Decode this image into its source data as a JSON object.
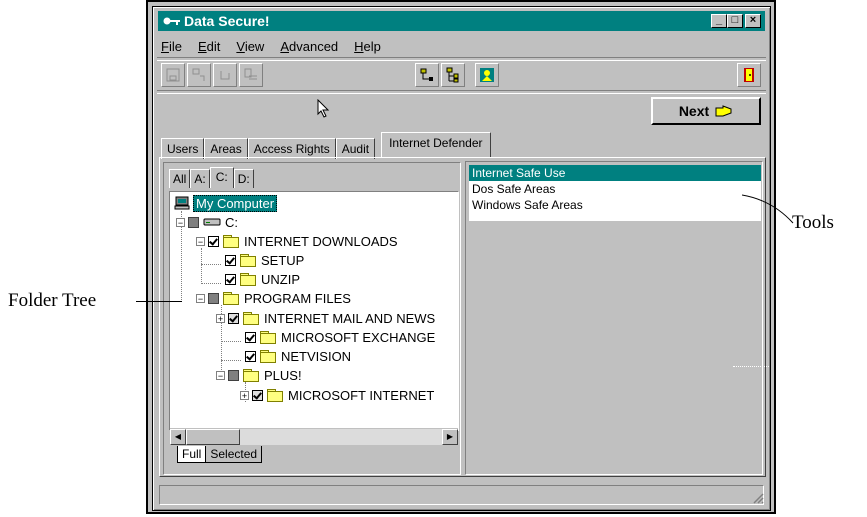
{
  "window": {
    "title": "Data Secure!",
    "min": "_",
    "max": "□",
    "close": "×"
  },
  "menu": [
    "File",
    "Edit",
    "View",
    "Advanced",
    "Help"
  ],
  "next_button": {
    "label": "Next"
  },
  "tabs": [
    "Users",
    "Areas",
    "Access Rights",
    "Audit",
    "Internet Defender"
  ],
  "drive_tabs": [
    "All",
    "A:",
    "C:",
    "D:"
  ],
  "tree": {
    "root": "My Computer",
    "drive": "C:",
    "items": [
      {
        "label": "INTERNET DOWNLOADS",
        "level": 2
      },
      {
        "label": "SETUP",
        "level": 3
      },
      {
        "label": "UNZIP",
        "level": 3
      },
      {
        "label": "PROGRAM FILES",
        "level": 2
      },
      {
        "label": "INTERNET MAIL AND NEWS",
        "level": 3
      },
      {
        "label": "MICROSOFT EXCHANGE",
        "level": 3
      },
      {
        "label": "NETVISION",
        "level": 3
      },
      {
        "label": "PLUS!",
        "level": 3
      },
      {
        "label": "MICROSOFT INTERNET",
        "level": 4
      }
    ]
  },
  "view_tabs": [
    "Full",
    "Selected"
  ],
  "tools_list": [
    "Internet Safe Use",
    "Dos Safe Areas",
    "Windows Safe Areas"
  ],
  "callouts": {
    "left": "Folder Tree",
    "right": "Tools"
  },
  "colors": {
    "titlebar": "#008080",
    "selection": "#008080",
    "face": "#c0c0c0"
  }
}
